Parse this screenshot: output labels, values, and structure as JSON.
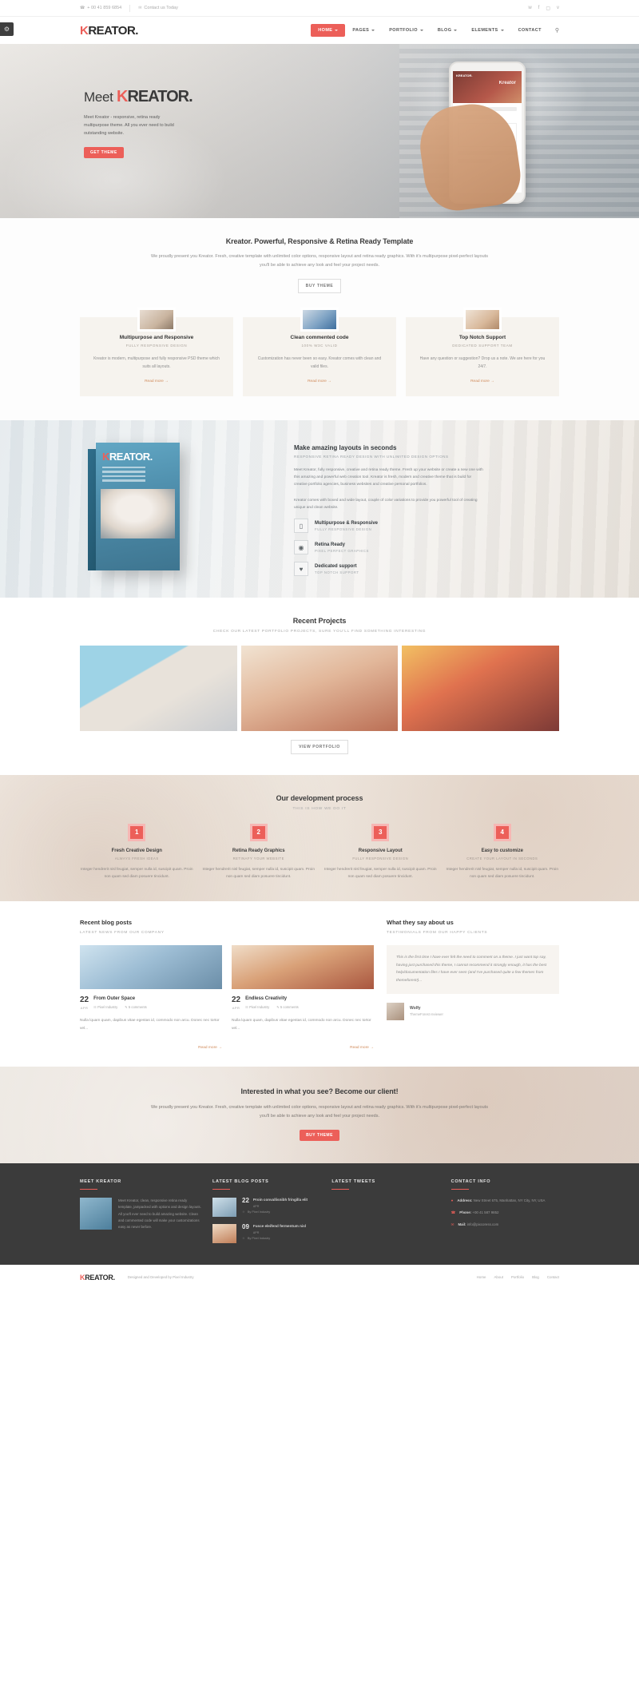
{
  "topbar": {
    "phone": "+ 00 41 859 6854",
    "contact": "Contact us Today",
    "phone_icon": "phone-icon",
    "mail_icon": "envelope-icon",
    "social": [
      "twitter-icon",
      "facebook-icon",
      "instagram-icon",
      "vimeo-icon"
    ]
  },
  "header": {
    "logo_k": "K",
    "logo_rest": "REATOR.",
    "nav": [
      {
        "label": "HOME",
        "caret": true,
        "active": true
      },
      {
        "label": "PAGES",
        "caret": true,
        "active": false
      },
      {
        "label": "PORTFOLIO",
        "caret": true,
        "active": false
      },
      {
        "label": "BLOG",
        "caret": true,
        "active": false
      },
      {
        "label": "ELEMENTS",
        "caret": true,
        "active": false
      },
      {
        "label": "CONTACT",
        "caret": false,
        "active": false
      }
    ],
    "search_icon": "search-icon",
    "settings_icon": "gear-icon"
  },
  "hero": {
    "pre": "Meet ",
    "brand_k": "K",
    "brand_rest": "REATOR.",
    "paragraph": "Meet Kreator - responsive, retina ready multipurpose theme. All you ever need to build outstanding website.",
    "button": "GET THEME",
    "phone_logo": "KREATOR.",
    "phone_badge": "Kreator"
  },
  "intro": {
    "title": "Kreator. Powerful, Responsive & Retina Ready Template",
    "paragraph": "We proudly present you Kreator. Fresh, creative template with unlimited color options, responsive layout and retina ready graphics. With it's multipurpose pixel-perfect layouts you'll be able to achieve any look and feel your project needs.",
    "button": "BUY THEME"
  },
  "services": [
    {
      "title": "Multipurpose and Responsive",
      "subtitle": "FULLY RESPONSIVE DESIGN",
      "text": "Kreator is modern, multipurpose and fully responsive PSD theme which suits all layouts.",
      "link": "Read more"
    },
    {
      "title": "Clean commented code",
      "subtitle": "100% W3C VALID",
      "text": "Customization has never been so easy. Kreator comes with clean and valid files.",
      "link": "Read more"
    },
    {
      "title": "Top Notch Support",
      "subtitle": "DEDICATED SUPPORT TEAM",
      "text": "Have any question or suggestion? Drop us a note. We are here for you 24/7.",
      "link": "Read more"
    }
  ],
  "layouts": {
    "title": "Make amazing layouts in seconds",
    "subtitle": "RESPONSIVE RETINA READY DESIGN WITH UNLIMITED DESIGN OPTIONS",
    "p1": "Meet Kreator, fully responsive, creative and retina ready theme. Fresh up your website or create a new one with this amazing and powerful web creation tool. Kreator is fresh, modern and creative theme that is build for creative portfolio agencies, business websites and creative personal portfolios.",
    "p2": "Kreator comes with boxed and wide layout, couple of color variations to provide you powerful tool of creating unique and clean website.",
    "box_logo_k": "K",
    "box_logo_rest": "REATOR.",
    "features": [
      {
        "icon": "monitor-icon",
        "glyph": "▭",
        "title": "Multipurpose & Responsive",
        "subtitle": "FULLY RESPONSIVE DESIGN"
      },
      {
        "icon": "eye-icon",
        "glyph": "◉",
        "title": "Retina Ready",
        "subtitle": "PIXEL PERFECT GRAPHICS"
      },
      {
        "icon": "heart-icon",
        "glyph": "♥",
        "title": "Dedicated support",
        "subtitle": "TOP NOTCH SUPPORT"
      }
    ]
  },
  "projects": {
    "title": "Recent Projects",
    "subtitle": "CHECK OUR LATEST PORTFOLIO PROJECTS, SURE YOU'LL FIND SOMETHING INTERESTING",
    "button": "VIEW PORTFOLIO",
    "items": [
      "project-astronaut",
      "project-magician",
      "project-coffee"
    ]
  },
  "process": {
    "title": "Our development process",
    "subtitle": "THIS IS HOW WE DO IT",
    "steps": [
      {
        "num": "1",
        "title": "Fresh Creative Design",
        "subtitle": "ALWAYS FRESH IDEAS",
        "text": "Integer hendrerit nisl feugiat, semper nulla id, suscipit quam. Proin non quam sed diam posuere tincidunt."
      },
      {
        "num": "2",
        "title": "Retina Ready Graphics",
        "subtitle": "RETINAFY YOUR WEBSITE",
        "text": "Integer hendrerit nisl feugiat, semper nulla id, suscipit quam. Proin non quam sed diam posuere tincidunt."
      },
      {
        "num": "3",
        "title": "Responsive Layout",
        "subtitle": "FULLY RESPONSIVE DESIGN",
        "text": "Integer hendrerit nisl feugiat, semper nulla id, suscipit quam. Proin non quam sed diam posuere tincidunt."
      },
      {
        "num": "4",
        "title": "Easy to customize",
        "subtitle": "CREATE YOUR LAYOUT IN SECONDS",
        "text": "Integer hendrerit nisl feugiat, semper nulla id, suscipit quam. Proin non quam sed diam posuere tincidunt."
      }
    ]
  },
  "blog": {
    "title": "Recent blog posts",
    "subtitle": "LATEST NEWS FROM OUR COMPANY",
    "posts": [
      {
        "day": "22",
        "month": "APR",
        "title": "From Outer Space",
        "cat_icon": "folder-icon",
        "category": "Pixel Industry",
        "comment_icon": "comment-icon",
        "comments": "5 comments",
        "excerpt": "Nulla lquam quam, dapibus vitae egestas id, commodo non arcu. Donec nec tortor vel...",
        "link": "Read more"
      },
      {
        "day": "22",
        "month": "APR",
        "title": "Endless Creativity",
        "cat_icon": "folder-icon",
        "category": "Pixel Industry",
        "comment_icon": "comment-icon",
        "comments": "5 comments",
        "excerpt": "Nulla lquam quam, dapibus vitae egestas id, commodo non arcu. Donec nec tortor vel...",
        "link": "Read more"
      }
    ]
  },
  "testimonials": {
    "title": "What they say about us",
    "subtitle": "TESTIMONIALS FROM OUR HAPPY CLIENTS",
    "quote": "This is the first time I have ever felt the need to comment on a theme. I just want top say, having just purchased this theme, I cannot recommend it strongly enough, it has the best help/documentation files I have ever seen (and I've purchased quite a few themes from themeforest!)...",
    "author": "Wolfy",
    "role": "ThemeForest reviewer"
  },
  "cta": {
    "title": "Interested in what you see? Become our client!",
    "paragraph": "We proudly present you Kreator. Fresh, creative template with unlimited color options, responsive layout and retina ready graphics. With it's multipurpose pixel-perfect layouts you'll be able to achieve any look and feel your project needs.",
    "button": "BUY THEME"
  },
  "footer": {
    "about": {
      "heading": "MEET KREATOR",
      "text": "Meet Kreator, clean, responsive retina ready template, jampacked with options and design layouts. All you'll ever need to build amazing website. Clean and commented code will make your customizations easy as never before."
    },
    "latest_posts": {
      "heading": "LATEST BLOG POSTS",
      "items": [
        {
          "day": "22",
          "month": "APR",
          "title": "Proin convallisnibh fringilla elit",
          "by": "By Pixel Industry"
        },
        {
          "day": "09",
          "month": "APR",
          "title": "Fusce eleifend fermentum nisl",
          "by": "By Pixel Industry"
        }
      ]
    },
    "tweets": {
      "heading": "LATEST TWEETS"
    },
    "contact": {
      "heading": "CONTACT INFO",
      "items": [
        {
          "icon": "location-icon",
          "label": "Address:",
          "value": "New Street 675, Manhattan, NY City, NY, USA"
        },
        {
          "icon": "phone-icon",
          "label": "Phone:",
          "value": "+00 41 587 9852"
        },
        {
          "icon": "envelope-icon",
          "label": "Mail:",
          "value": "info@pixcoress.com"
        }
      ]
    }
  },
  "subfooter": {
    "logo_k": "K",
    "logo_rest": "REATOR.",
    "credit": "Designed and Developed by Pixel Industry",
    "nav": [
      "Home",
      "About",
      "Portfolio",
      "Blog",
      "Contact"
    ]
  },
  "colors": {
    "accent": "#ec5f59",
    "dark": "#3b3b3b",
    "muted": "#8c8c8c"
  }
}
